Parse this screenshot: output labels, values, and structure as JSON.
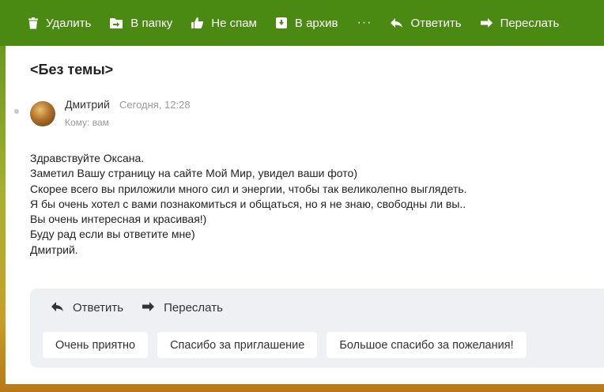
{
  "toolbar": {
    "delete": "Удалить",
    "to_folder": "В папку",
    "not_spam": "Не спам",
    "archive": "В архив",
    "more": "···",
    "reply": "Ответить",
    "forward": "Переслать"
  },
  "message": {
    "subject": "<Без темы>",
    "sender_name": "Дмитрий",
    "date": "Сегодня, 12:28",
    "recipient": "Кому: вам",
    "body_lines": [
      "Здравствуйте Оксана.",
      "Заметил Вашу страницу на сайте Мой Мир, увидел ваши фото)",
      "Скорее всего вы приложили много сил и энергии, чтобы так великолепно выглядеть.",
      "Я бы очень хотел с вами познакомиться и общаться, но я не знаю, свободны ли вы..",
      "Вы очень интересная и красивая!)",
      "Буду рад если вы ответите мне)",
      "Дмитрий."
    ]
  },
  "reply_box": {
    "reply": "Ответить",
    "forward": "Переслать",
    "quick_replies": [
      "Очень приятно",
      "Спасибо за приглашение",
      "Большое спасибо за пожелания!"
    ]
  }
}
